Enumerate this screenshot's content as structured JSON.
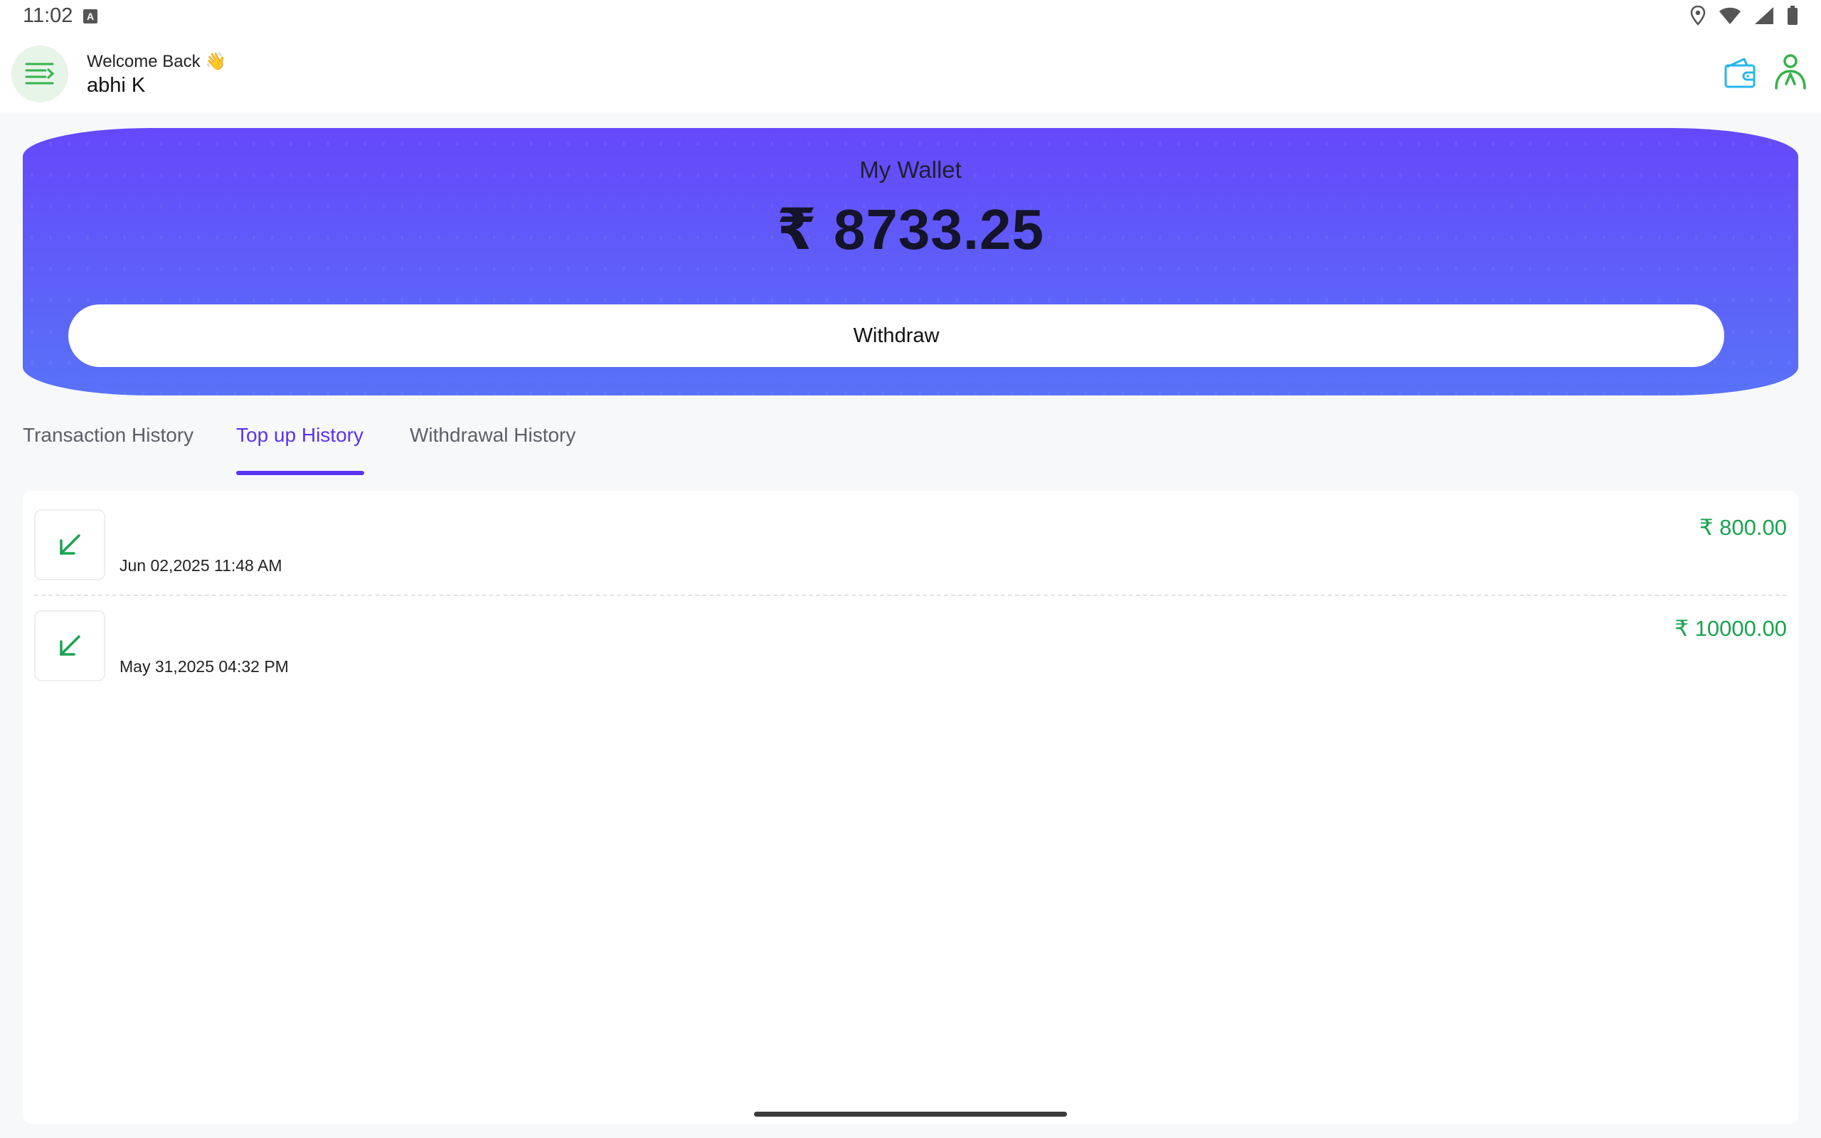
{
  "status_bar": {
    "time": "11:02",
    "notification_icon": "a-icon",
    "icons": [
      "location-icon",
      "wifi-icon",
      "signal-icon",
      "battery-icon"
    ]
  },
  "header": {
    "welcome_text": "Welcome Back 👋",
    "username": "abhi K",
    "menu_icon": "menu-icon",
    "wallet_icon": "wallet-icon",
    "profile_icon": "profile-icon"
  },
  "wallet": {
    "title": "My Wallet",
    "balance": "₹ 8733.25",
    "withdraw_label": "Withdraw"
  },
  "tabs": [
    {
      "label": "Transaction History",
      "active": false
    },
    {
      "label": "Top up History",
      "active": true
    },
    {
      "label": "Withdrawal History",
      "active": false
    }
  ],
  "history": [
    {
      "icon": "arrow-down-left-icon",
      "date": "Jun 02,2025 11:48 AM",
      "amount": "₹ 800.00"
    },
    {
      "icon": "arrow-down-left-icon",
      "date": "May 31,2025 04:32 PM",
      "amount": "₹ 10000.00"
    }
  ],
  "colors": {
    "accent": "#5b33f3",
    "card_top": "#6548fb",
    "card_bottom": "#5872f7",
    "credit_green": "#1aa350"
  }
}
